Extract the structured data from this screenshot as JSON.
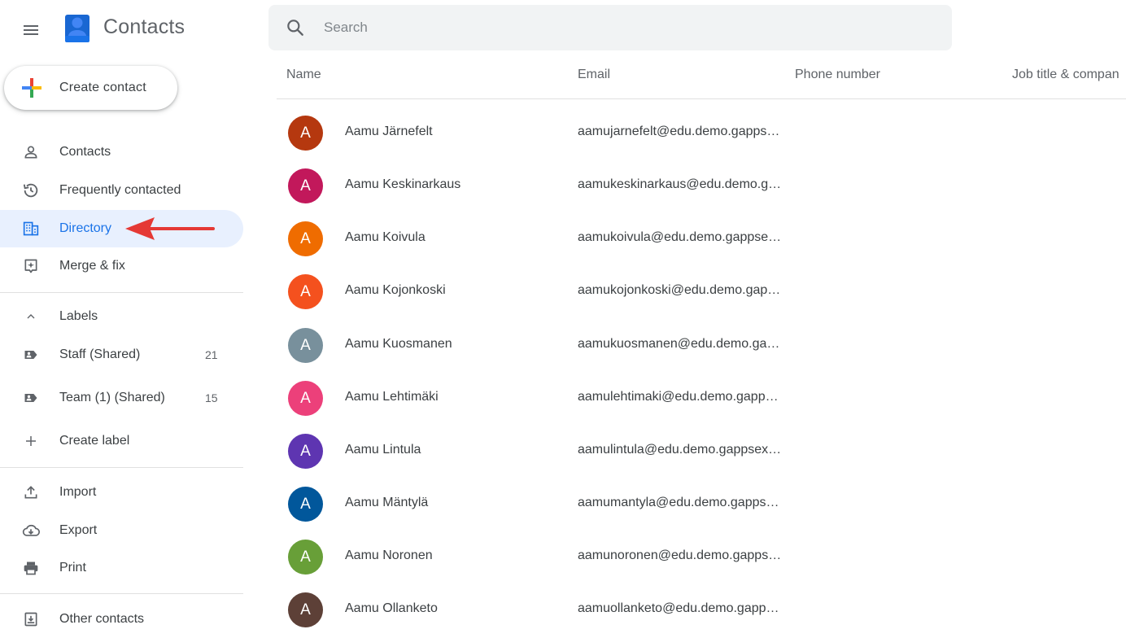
{
  "app": {
    "title": "Contacts",
    "menu_icon": "hamburger-menu-icon",
    "logo_icon": "contacts-person-icon"
  },
  "search": {
    "placeholder": "Search",
    "value": ""
  },
  "sidebar": {
    "create_contact_label": "Create contact",
    "nav": [
      {
        "label": "Contacts",
        "icon": "person-outline-icon",
        "active": false
      },
      {
        "label": "Frequently contacted",
        "icon": "history-icon",
        "active": false
      },
      {
        "label": "Directory",
        "icon": "directory-building-icon",
        "active": true
      },
      {
        "label": "Merge & fix",
        "icon": "merge-fix-icon",
        "active": false
      }
    ],
    "labels_header": "Labels",
    "labels": [
      {
        "label": "Staff (Shared)",
        "count": "21",
        "icon": "label-shared-icon"
      },
      {
        "label": "Team (1) (Shared)",
        "count": "15",
        "icon": "label-shared-icon"
      }
    ],
    "create_label": "Create label",
    "tools": [
      {
        "label": "Import",
        "icon": "upload-icon"
      },
      {
        "label": "Export",
        "icon": "cloud-download-icon"
      },
      {
        "label": "Print",
        "icon": "printer-icon"
      }
    ],
    "other_contacts": "Other contacts"
  },
  "table": {
    "columns": [
      "Name",
      "Email",
      "Phone number",
      "Job title & compan"
    ],
    "rows": [
      {
        "initial": "A",
        "name": "Aamu Järnefelt",
        "email": "aamujarnefelt@edu.demo.gapps…",
        "color": "#b5380f"
      },
      {
        "initial": "A",
        "name": "Aamu Keskinarkaus",
        "email": "aamukeskinarkaus@edu.demo.g…",
        "color": "#c2185b"
      },
      {
        "initial": "A",
        "name": "Aamu Koivula",
        "email": "aamukoivula@edu.demo.gappse…",
        "color": "#ef6c00"
      },
      {
        "initial": "A",
        "name": "Aamu Kojonkoski",
        "email": "aamukojonkoski@edu.demo.gap…",
        "color": "#f4511e"
      },
      {
        "initial": "A",
        "name": "Aamu Kuosmanen",
        "email": "aamukuosmanen@edu.demo.ga…",
        "color": "#78909c"
      },
      {
        "initial": "A",
        "name": "Aamu Lehtimäki",
        "email": "aamulehtimaki@edu.demo.gapp…",
        "color": "#ec407a"
      },
      {
        "initial": "A",
        "name": "Aamu Lintula",
        "email": "aamulintula@edu.demo.gappsex…",
        "color": "#5e35b1"
      },
      {
        "initial": "A",
        "name": "Aamu Mäntylä",
        "email": "aamumantyla@edu.demo.gapps…",
        "color": "#01579b"
      },
      {
        "initial": "A",
        "name": "Aamu Noronen",
        "email": "aamunoronen@edu.demo.gapps…",
        "color": "#689f38"
      },
      {
        "initial": "A",
        "name": "Aamu Ollanketo",
        "email": "aamuollanketo@edu.demo.gapp…",
        "color": "#5d4037"
      }
    ]
  },
  "colors": {
    "accent": "#1a73e8",
    "active_bg": "#e8f0fe",
    "annotation_arrow": "#e53935"
  }
}
